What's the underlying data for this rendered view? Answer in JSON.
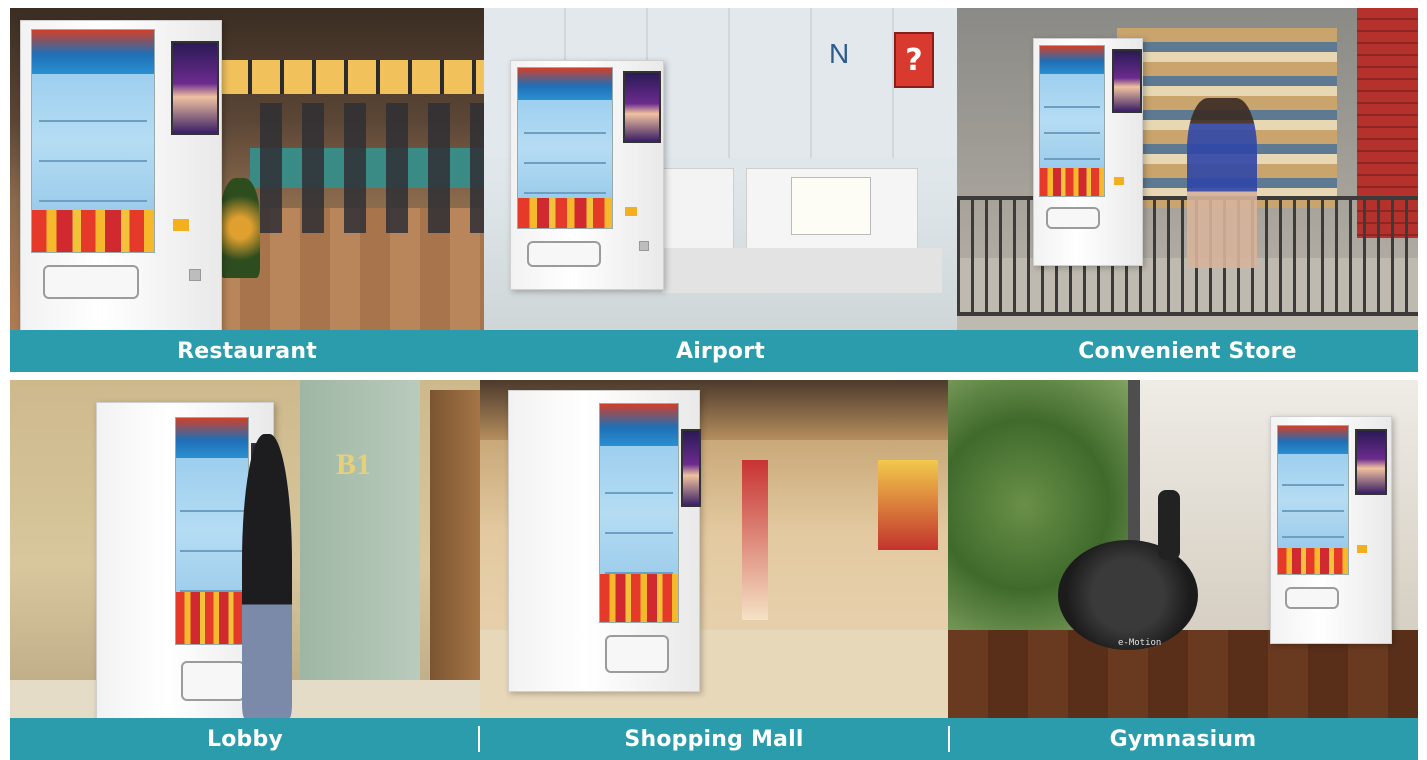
{
  "captions": {
    "restaurant": "Restaurant",
    "airport": "Airport",
    "convenient_store": "Convenient Store",
    "lobby": "Lobby",
    "shopping_mall": "Shopping Mall",
    "gymnasium": "Gymnasium"
  },
  "signage": {
    "airport_sign_letter": "N",
    "airport_info_sign": "?",
    "lobby_floor": "B1",
    "gym_bike_brand": "e-Motion"
  },
  "colors": {
    "caption_bar": "#2a9cab",
    "caption_text": "#ffffff"
  }
}
